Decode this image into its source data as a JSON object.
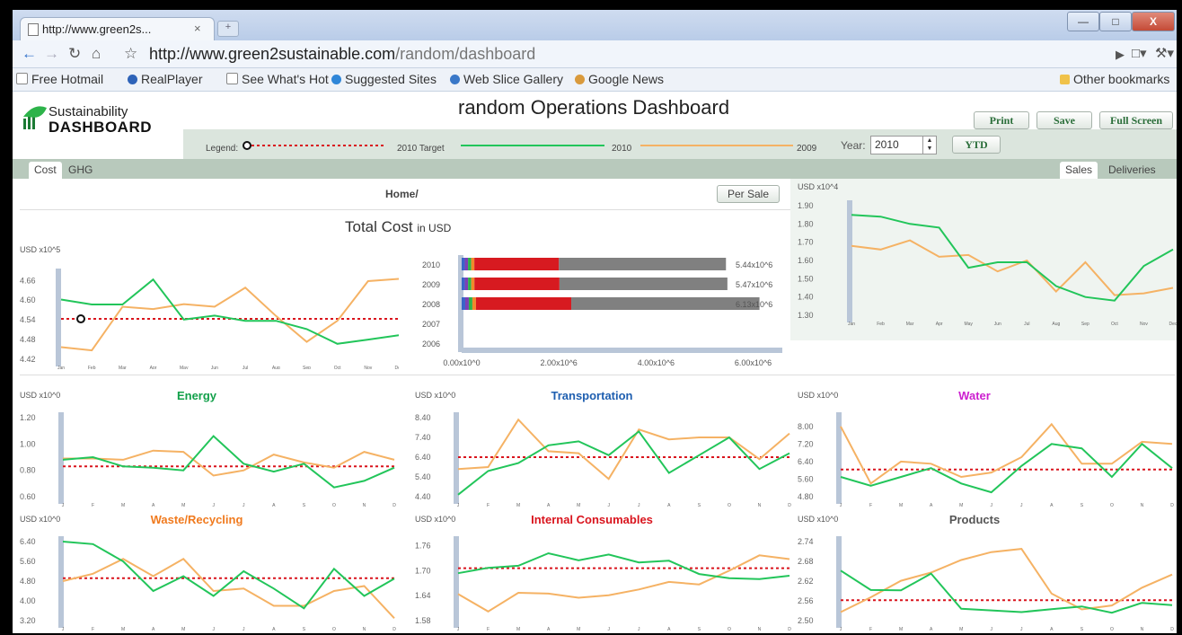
{
  "browser": {
    "tab_title": "http://www.green2s...",
    "tab_close": "×",
    "url_host": "http://www.green2sustainable.com",
    "url_path": "/random/dashboard",
    "bookmarks": [
      "Free Hotmail",
      "RealPlayer",
      "See What's Hot",
      "Suggested Sites",
      "Web Slice Gallery",
      "Google News"
    ],
    "other_bookmarks": "Other bookmarks",
    "bookmark_icon_colors": [
      "#3b73c7",
      "#2e63b8",
      "#3b73c7",
      "#2f86d8",
      "#3a78c8",
      "#5a8ad0"
    ]
  },
  "header": {
    "logo_line1": "Sustainability",
    "logo_line2": "DASHBOARD",
    "title": "random Operations Dashboard",
    "print": "Print",
    "save": "Save",
    "fullscreen": "Full Screen",
    "legend_label": "Legend:",
    "legend_target": "2010 Target",
    "legend_2010": "2010",
    "legend_2009": "2009",
    "year_label": "Year:",
    "year_value": "2010",
    "ytd": "YTD"
  },
  "tabs": {
    "left": [
      "Cost",
      "GHG"
    ],
    "right": [
      "Sales",
      "Deliveries"
    ]
  },
  "breadcrumb": "Home/",
  "per_sale": "Per Sale",
  "colors": {
    "y2010": "#22c55a",
    "y2009": "#f5b264",
    "target": "#d9141d",
    "axis": "#b9c6d8"
  },
  "chart_data": [
    {
      "id": "total",
      "type": "line",
      "title": "Total Cost",
      "title_suffix": "in USD",
      "unit": "USD x10^5",
      "ylim": [
        4.42,
        4.68
      ],
      "yticks": [
        "4.66",
        "4.60",
        "4.54",
        "4.48",
        "4.42"
      ],
      "x": [
        "Jan",
        "Feb",
        "Mar",
        "Apr",
        "May",
        "Jun",
        "Jul",
        "Aug",
        "Sep",
        "Oct",
        "Nov",
        "Dec"
      ],
      "target": 4.543,
      "series": [
        {
          "name": "2010",
          "values": [
            4.602,
            4.587,
            4.587,
            4.663,
            4.541,
            4.553,
            4.537,
            4.537,
            4.512,
            4.467,
            4.48,
            4.493
          ]
        },
        {
          "name": "2009",
          "values": [
            4.457,
            4.447,
            4.58,
            4.573,
            4.588,
            4.58,
            4.638,
            4.552,
            4.473,
            4.537,
            4.658,
            4.665
          ]
        }
      ]
    },
    {
      "id": "yearly",
      "type": "bar",
      "categories": [
        "2010",
        "2009",
        "2008",
        "2007",
        "2006"
      ],
      "values": [
        5.44,
        5.47,
        6.13,
        0,
        0
      ],
      "labels": [
        "5.44x10^6",
        "5.47x10^6",
        "6.13x10^6",
        "",
        ""
      ],
      "xticks": [
        "0.00x10^0",
        "2.00x10^6",
        "4.00x10^6",
        "6.00x10^6"
      ],
      "xlim": [
        0,
        6.6
      ]
    },
    {
      "id": "sales",
      "type": "line",
      "unit": "USD x10^4",
      "ylim": [
        1.3,
        1.9
      ],
      "yticks": [
        "1.90",
        "1.80",
        "1.70",
        "1.60",
        "1.50",
        "1.40",
        "1.30"
      ],
      "x": [
        "Jan",
        "Feb",
        "Mar",
        "Apr",
        "May",
        "Jun",
        "Jul",
        "Aug",
        "Sep",
        "Oct",
        "Nov",
        "Dec"
      ],
      "series": [
        {
          "name": "2010",
          "values": [
            1.85,
            1.84,
            1.8,
            1.78,
            1.56,
            1.59,
            1.59,
            1.46,
            1.4,
            1.38,
            1.57,
            1.66
          ]
        },
        {
          "name": "2009",
          "values": [
            1.68,
            1.66,
            1.71,
            1.62,
            1.63,
            1.54,
            1.6,
            1.43,
            1.59,
            1.41,
            1.42,
            1.45
          ]
        }
      ]
    },
    {
      "id": "energy",
      "type": "line",
      "title": "Energy",
      "title_color": "#12a04a",
      "unit": "USD x10^0",
      "ylim": [
        0.6,
        1.2
      ],
      "yticks": [
        "1.20",
        "1.00",
        "0.80",
        "0.60"
      ],
      "x": [
        "J",
        "F",
        "M",
        "A",
        "M",
        "J",
        "J",
        "A",
        "S",
        "O",
        "N",
        "D"
      ],
      "target": 0.83,
      "series": [
        {
          "name": "2010",
          "values": [
            0.88,
            0.9,
            0.83,
            0.82,
            0.8,
            1.06,
            0.85,
            0.79,
            0.85,
            0.67,
            0.72,
            0.82
          ]
        },
        {
          "name": "2009",
          "values": [
            0.89,
            0.89,
            0.88,
            0.95,
            0.94,
            0.76,
            0.8,
            0.92,
            0.86,
            0.82,
            0.94,
            0.88
          ]
        }
      ]
    },
    {
      "id": "transportation",
      "type": "line",
      "title": "Transportation",
      "title_color": "#1f5fb0",
      "unit": "USD x10^0",
      "ylim": [
        4.4,
        8.4
      ],
      "yticks": [
        "8.40",
        "7.40",
        "6.40",
        "5.40",
        "4.40"
      ],
      "x": [
        "J",
        "F",
        "M",
        "A",
        "M",
        "J",
        "J",
        "A",
        "S",
        "O",
        "N",
        "D"
      ],
      "target": 6.4,
      "series": [
        {
          "name": "2010",
          "values": [
            4.5,
            5.7,
            6.1,
            7.0,
            7.2,
            6.5,
            7.7,
            5.6,
            6.5,
            7.4,
            5.8,
            6.6
          ]
        },
        {
          "name": "2009",
          "values": [
            5.8,
            5.9,
            8.3,
            6.7,
            6.6,
            5.3,
            7.8,
            7.3,
            7.4,
            7.4,
            6.3,
            7.6
          ]
        }
      ]
    },
    {
      "id": "water",
      "type": "line",
      "title": "Water",
      "title_color": "#cc1fcf",
      "unit": "USD x10^0",
      "ylim": [
        4.8,
        8.4
      ],
      "yticks": [
        "8.00",
        "7.20",
        "6.40",
        "5.60",
        "4.80"
      ],
      "x": [
        "J",
        "F",
        "M",
        "A",
        "M",
        "J",
        "J",
        "A",
        "S",
        "O",
        "N",
        "D"
      ],
      "target": 6.04,
      "series": [
        {
          "name": "2010",
          "values": [
            5.7,
            5.3,
            5.7,
            6.1,
            5.4,
            5.0,
            6.2,
            7.2,
            7.0,
            5.7,
            7.2,
            6.1
          ]
        },
        {
          "name": "2009",
          "values": [
            8.0,
            5.4,
            6.4,
            6.3,
            5.7,
            5.9,
            6.6,
            8.1,
            6.3,
            6.3,
            7.3,
            7.2
          ]
        }
      ]
    },
    {
      "id": "waste",
      "type": "line",
      "title": "Waste/Recycling",
      "title_color": "#f07a1e",
      "unit": "USD x10^0",
      "ylim": [
        3.2,
        6.4
      ],
      "yticks": [
        "6.40",
        "5.60",
        "4.80",
        "4.00",
        "3.20"
      ],
      "x": [
        "J",
        "F",
        "M",
        "A",
        "M",
        "J",
        "J",
        "A",
        "S",
        "O",
        "N",
        "D"
      ],
      "target": 4.92,
      "series": [
        {
          "name": "2010",
          "values": [
            6.4,
            6.3,
            5.6,
            4.4,
            5.0,
            4.2,
            5.2,
            4.5,
            3.7,
            5.3,
            4.2,
            4.9
          ]
        },
        {
          "name": "2009",
          "values": [
            4.8,
            5.1,
            5.7,
            5.0,
            5.7,
            4.4,
            4.5,
            3.8,
            3.8,
            4.4,
            4.6,
            3.3
          ]
        }
      ]
    },
    {
      "id": "consumables",
      "type": "line",
      "title": "Internal Consumables",
      "title_color": "#d9141d",
      "unit": "USD x10^0",
      "ylim": [
        1.58,
        1.77
      ],
      "yticks": [
        "1.76",
        "1.70",
        "1.64",
        "1.58"
      ],
      "x": [
        "J",
        "F",
        "M",
        "A",
        "M",
        "J",
        "J",
        "A",
        "S",
        "O",
        "N",
        "D"
      ],
      "target": 1.706,
      "series": [
        {
          "name": "2010",
          "values": [
            1.694,
            1.707,
            1.712,
            1.742,
            1.725,
            1.739,
            1.72,
            1.724,
            1.692,
            1.682,
            1.68,
            1.688
          ]
        },
        {
          "name": "2009",
          "values": [
            1.644,
            1.602,
            1.647,
            1.645,
            1.635,
            1.641,
            1.655,
            1.673,
            1.667,
            1.7,
            1.737,
            1.728
          ]
        }
      ]
    },
    {
      "id": "products",
      "type": "line",
      "title": "Products",
      "title_color": "#555555",
      "unit": "USD x10^0",
      "ylim": [
        2.5,
        2.74
      ],
      "yticks": [
        "2.74",
        "2.68",
        "2.62",
        "2.56",
        "2.50"
      ],
      "x": [
        "J",
        "F",
        "M",
        "A",
        "M",
        "J",
        "J",
        "A",
        "S",
        "O",
        "N",
        "D"
      ],
      "target": 2.562,
      "series": [
        {
          "name": "2010",
          "values": [
            2.652,
            2.593,
            2.592,
            2.643,
            2.536,
            2.531,
            2.526,
            2.535,
            2.543,
            2.524,
            2.554,
            2.547
          ]
        },
        {
          "name": "2009",
          "values": [
            2.526,
            2.571,
            2.621,
            2.646,
            2.684,
            2.708,
            2.718,
            2.582,
            2.534,
            2.546,
            2.6,
            2.64
          ]
        }
      ]
    }
  ]
}
